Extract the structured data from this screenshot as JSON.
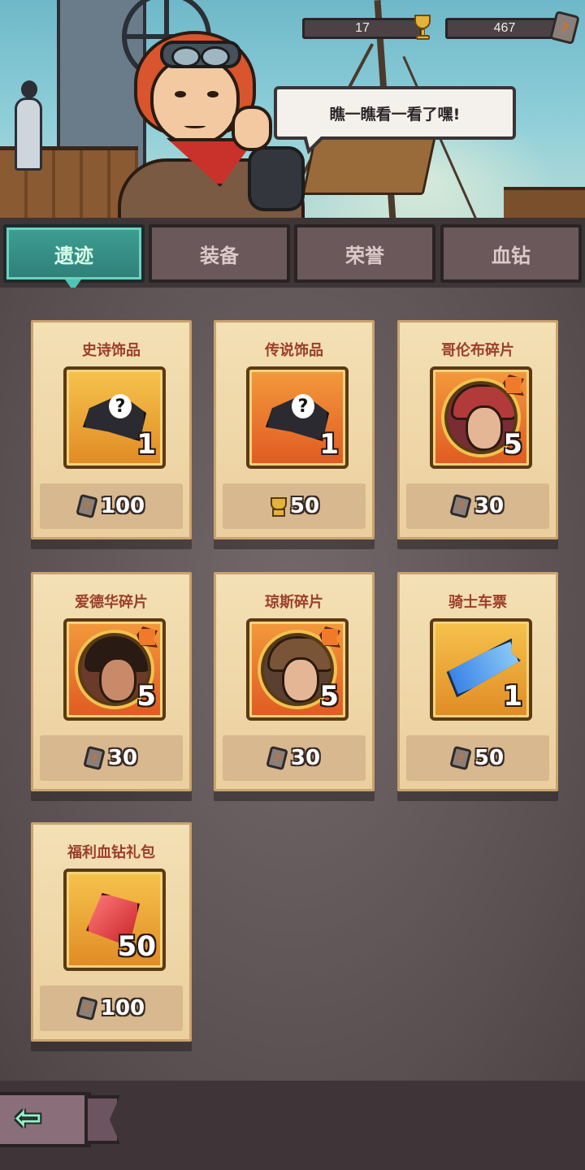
{
  "header": {
    "trophy_count": "17",
    "stone_count": "467",
    "stone_icon": "?"
  },
  "npc": {
    "speech": "瞧一瞧看一看了嘿!"
  },
  "tabs": [
    {
      "label": "遗迹",
      "active": true
    },
    {
      "label": "装备",
      "active": false
    },
    {
      "label": "荣誉",
      "active": false
    },
    {
      "label": "血钻",
      "active": false
    }
  ],
  "items": [
    {
      "title": "史诗饰品",
      "qty": "1",
      "price": "100",
      "currency": "stone",
      "icon": "mystery-mask-icon",
      "q": "?"
    },
    {
      "title": "传说饰品",
      "qty": "1",
      "price": "50",
      "currency": "trophy",
      "icon": "mystery-mask-icon",
      "q": "?"
    },
    {
      "title": "哥伦布碎片",
      "qty": "5",
      "price": "30",
      "currency": "stone",
      "icon": "columbus-portrait-icon"
    },
    {
      "title": "爱德华碎片",
      "qty": "5",
      "price": "30",
      "currency": "stone",
      "icon": "edward-portrait-icon"
    },
    {
      "title": "琼斯碎片",
      "qty": "5",
      "price": "30",
      "currency": "stone",
      "icon": "jones-portrait-icon"
    },
    {
      "title": "骑士车票",
      "qty": "1",
      "price": "50",
      "currency": "stone",
      "icon": "ticket-icon"
    },
    {
      "title": "福利血钻礼包",
      "qty": "50",
      "price": "100",
      "currency": "stone",
      "icon": "ruby-icon"
    }
  ],
  "colors": {
    "active_tab": "#3d9f93",
    "inactive_tab": "#6a585a",
    "card_bg": "#f3e0b4",
    "title_red": "#9c3f28"
  },
  "back": {
    "arrow": "⇦"
  }
}
